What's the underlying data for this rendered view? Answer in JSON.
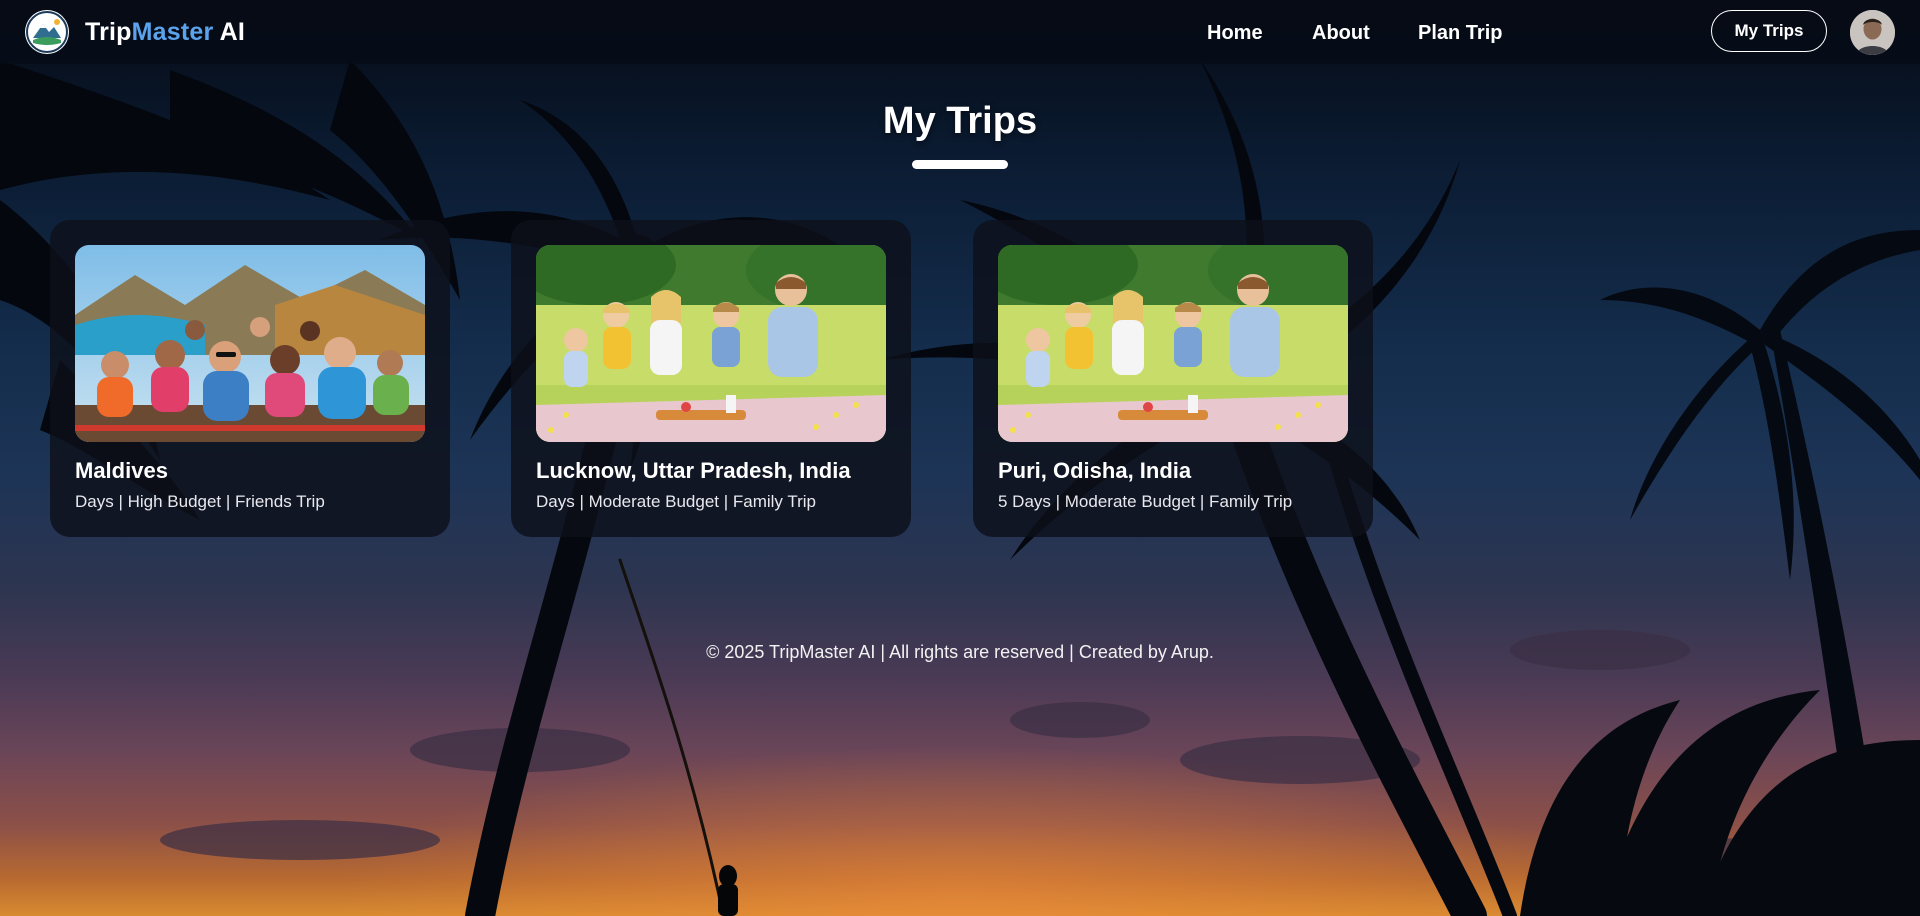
{
  "brand": {
    "name_part1": "Trip",
    "name_part2": "Master",
    "name_part3": " AI",
    "accent_color": "#5ba3ec"
  },
  "nav": {
    "links": [
      {
        "label": "Home"
      },
      {
        "label": "About"
      },
      {
        "label": "Plan Trip"
      }
    ],
    "my_trips_button": "My Trips",
    "avatar_icon": "user-avatar"
  },
  "page": {
    "title": "My Trips"
  },
  "trips": [
    {
      "title": "Maldives",
      "meta": "Days | High Budget | Friends Trip",
      "image_icon": "friends-group-photo"
    },
    {
      "title": "Lucknow, Uttar Pradesh, India",
      "meta": "Days | Moderate Budget | Family Trip",
      "image_icon": "family-picnic-photo"
    },
    {
      "title": "Puri, Odisha, India",
      "meta": "5 Days | Moderate Budget | Family Trip",
      "image_icon": "family-picnic-photo"
    }
  ],
  "footer": {
    "text": "© 2025 TripMaster AI | All rights are reserved | Created by Arup."
  }
}
